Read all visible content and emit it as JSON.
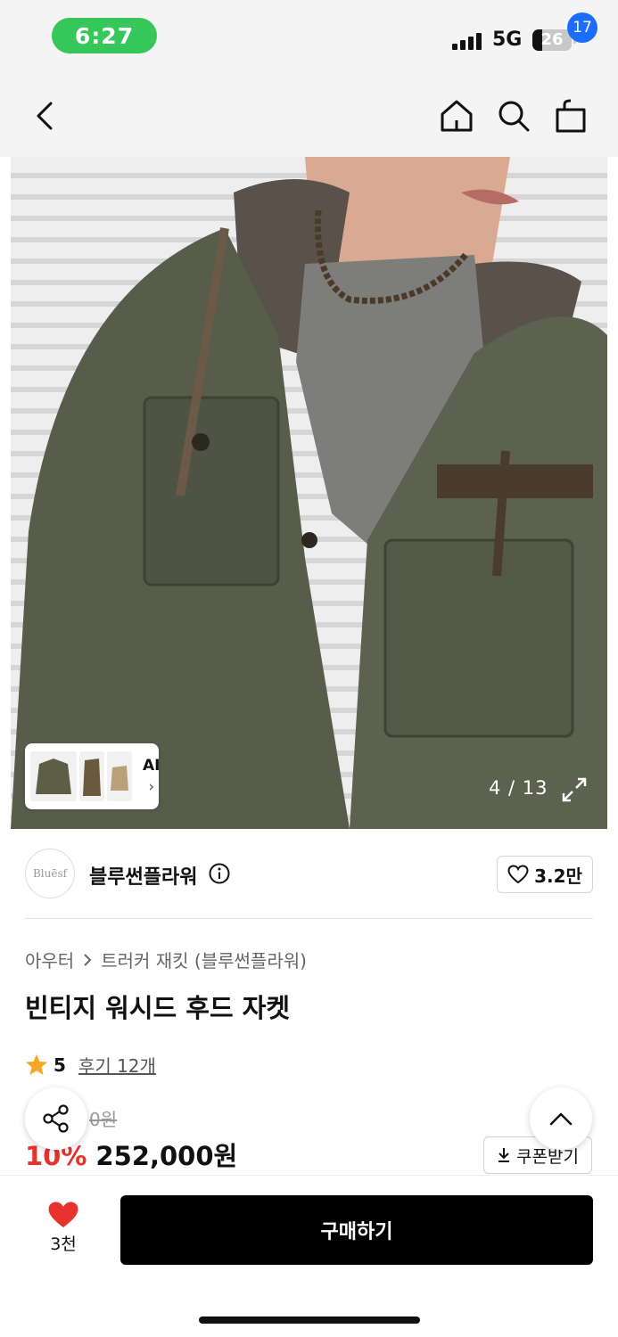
{
  "status": {
    "time": "6:27",
    "network": "5G",
    "battery": "26",
    "battery_level_pct": 26
  },
  "nav": {
    "cart_count": "17",
    "icons": [
      "back-icon",
      "home-icon",
      "search-icon",
      "cart-icon"
    ]
  },
  "gallery": {
    "counter": "4 / 13",
    "ai_label": "AI",
    "ai_chevron": "›"
  },
  "brand": {
    "logo_text": "Bluēsf",
    "name": "블루썬플라워",
    "like_count": "3.2만"
  },
  "product": {
    "breadcrumb": [
      "아우터",
      "트러커 재킷 (블루썬플라워)"
    ],
    "title": "빈티지 워시드 후드 자켓",
    "rating": "5",
    "reviews": "후기 12개",
    "original_price": "0원",
    "discount": "10%",
    "price": "252,000원",
    "coupon_label": "쿠폰받기"
  },
  "bottom": {
    "wish_count": "3천",
    "buy_label": "구매하기"
  },
  "colors": {
    "accent_green": "#35c759",
    "badge_blue": "#1a6dff",
    "discount_red": "#e8322e",
    "heart_red": "#e8322e",
    "star_orange": "#f5a623"
  }
}
